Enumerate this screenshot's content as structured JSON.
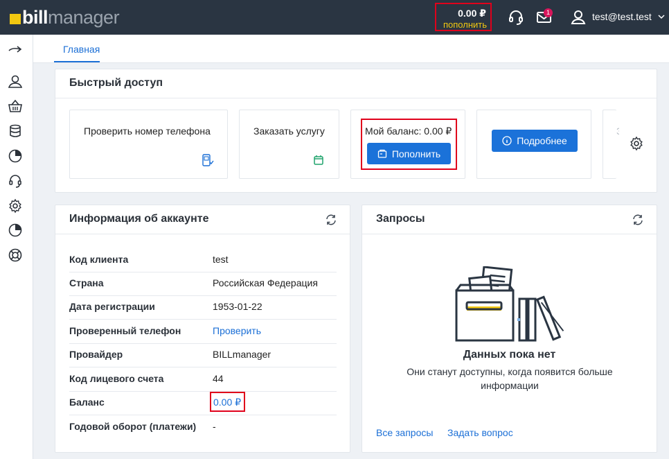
{
  "header": {
    "logo_bill": "bill",
    "logo_manager": "manager",
    "balance_amount": "0.00 ₽",
    "balance_topup": "пополнить",
    "notifications_count": "1",
    "user": "test@test.test"
  },
  "tabs": [
    {
      "label": "Главная",
      "active": true
    }
  ],
  "quick_access": {
    "title": "Быстрый доступ",
    "check_phone": "Проверить номер телефона",
    "order_service": "Заказать услугу",
    "my_balance": "Мой баланс: 0.00 ₽",
    "topup_button": "Пополнить",
    "details_button": "Подробнее",
    "partial_tile": "З"
  },
  "account_info": {
    "title": "Информация об аккаунте",
    "rows": [
      {
        "label": "Код клиента",
        "value": "test"
      },
      {
        "label": "Страна",
        "value": "Российская Федерация"
      },
      {
        "label": "Дата регистрации",
        "value": "1953-01-22"
      },
      {
        "label": "Проверенный телефон",
        "value": "Проверить"
      },
      {
        "label": "Провайдер",
        "value": "BILLmanager"
      },
      {
        "label": "Код лицевого счета",
        "value": "44"
      },
      {
        "label": "Баланс",
        "value": "0.00 ₽"
      },
      {
        "label": "Годовой оборот (платежи)",
        "value": "-"
      }
    ]
  },
  "requests": {
    "title": "Запросы",
    "empty_title": "Данных пока нет",
    "empty_subtitle": "Они станут доступны, когда появится больше информации",
    "all_requests": "Все запросы",
    "ask_question": "Задать вопрос"
  },
  "colors": {
    "topbar": "#2a3542",
    "accent": "#1b72d9",
    "brand_yellow": "#f2c811",
    "highlight_red": "#e0001b",
    "badge": "#d8155b"
  },
  "icons": {
    "top": [
      "support-headset-icon",
      "mail-icon",
      "user-icon",
      "chevron-down-icon"
    ],
    "sidebar": [
      "collapse-arrow-icon",
      "user-icon",
      "basket-icon",
      "database-icon",
      "pie-chart-icon",
      "support-headset-icon",
      "gear-icon",
      "pie-chart-icon",
      "lifebuoy-icon"
    ]
  }
}
